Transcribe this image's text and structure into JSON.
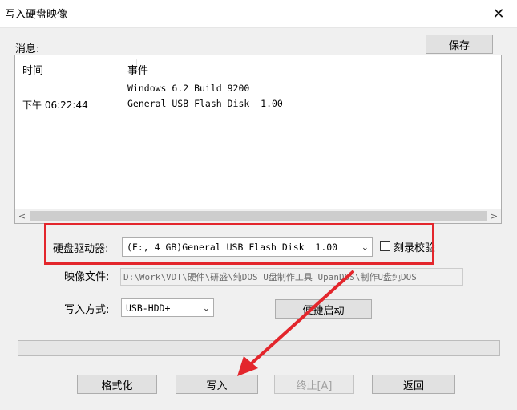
{
  "window": {
    "title": "写入硬盘映像",
    "close_glyph": "✕"
  },
  "messages": {
    "label": "消息:",
    "save_button": "保存",
    "columns": [
      "时间",
      "事件"
    ],
    "rows": [
      {
        "time": "",
        "event": "Windows 6.2 Build 9200"
      },
      {
        "time": "下午 06:22:44",
        "event": "General USB Flash Disk  1.00"
      }
    ],
    "scroll_left": "<",
    "scroll_right": ">"
  },
  "drive": {
    "label": "硬盘驱动器:",
    "value": "(F:, 4 GB)General USB Flash Disk  1.00",
    "verify_label": "刻录校验",
    "verify_checked": false
  },
  "image_file": {
    "label": "映像文件:",
    "value": "D:\\Work\\VDT\\硬件\\研盛\\纯DOS U盘制作工具 UpanDOS\\制作U盘纯DOS"
  },
  "write_mode": {
    "label": "写入方式:",
    "value": "USB-HDD+",
    "boot_button": "便捷启动"
  },
  "progress_percent": 0,
  "buttons": {
    "format": "格式化",
    "write": "写入",
    "abort": "终止[A]",
    "back": "返回"
  },
  "annotation": {
    "color": "#e3262c"
  }
}
